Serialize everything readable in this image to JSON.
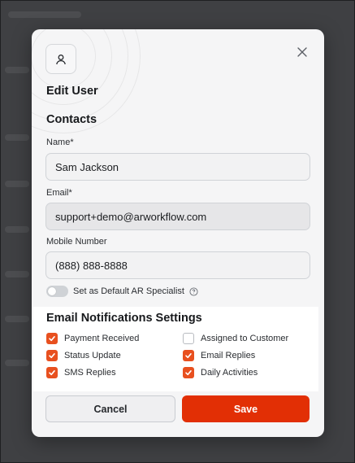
{
  "modal": {
    "title": "Edit User",
    "close_icon": "close-icon",
    "avatar_icon": "user-icon"
  },
  "contacts": {
    "section_title": "Contacts",
    "name": {
      "label": "Name*",
      "value": "Sam Jackson"
    },
    "email": {
      "label": "Email*",
      "value": "support+demo@arworkflow.com"
    },
    "mobile": {
      "label": "Mobile Number",
      "value": "(888) 888-8888"
    },
    "default_specialist": {
      "label": "Set as Default AR Specialist",
      "enabled": false,
      "help_icon": "help-circle-icon"
    }
  },
  "notifications": {
    "title": "Email Notifications Settings",
    "items": [
      {
        "label": "Payment Received",
        "checked": true
      },
      {
        "label": "Assigned to Customer",
        "checked": false
      },
      {
        "label": "Status Update",
        "checked": true
      },
      {
        "label": "Email Replies",
        "checked": true
      },
      {
        "label": "SMS Replies",
        "checked": true
      },
      {
        "label": "Daily Activities",
        "checked": true
      }
    ]
  },
  "actions": {
    "cancel_label": "Cancel",
    "save_label": "Save"
  },
  "colors": {
    "accent": "#e22f05",
    "checkbox": "#e8501f",
    "overlay": "#3f4043"
  }
}
